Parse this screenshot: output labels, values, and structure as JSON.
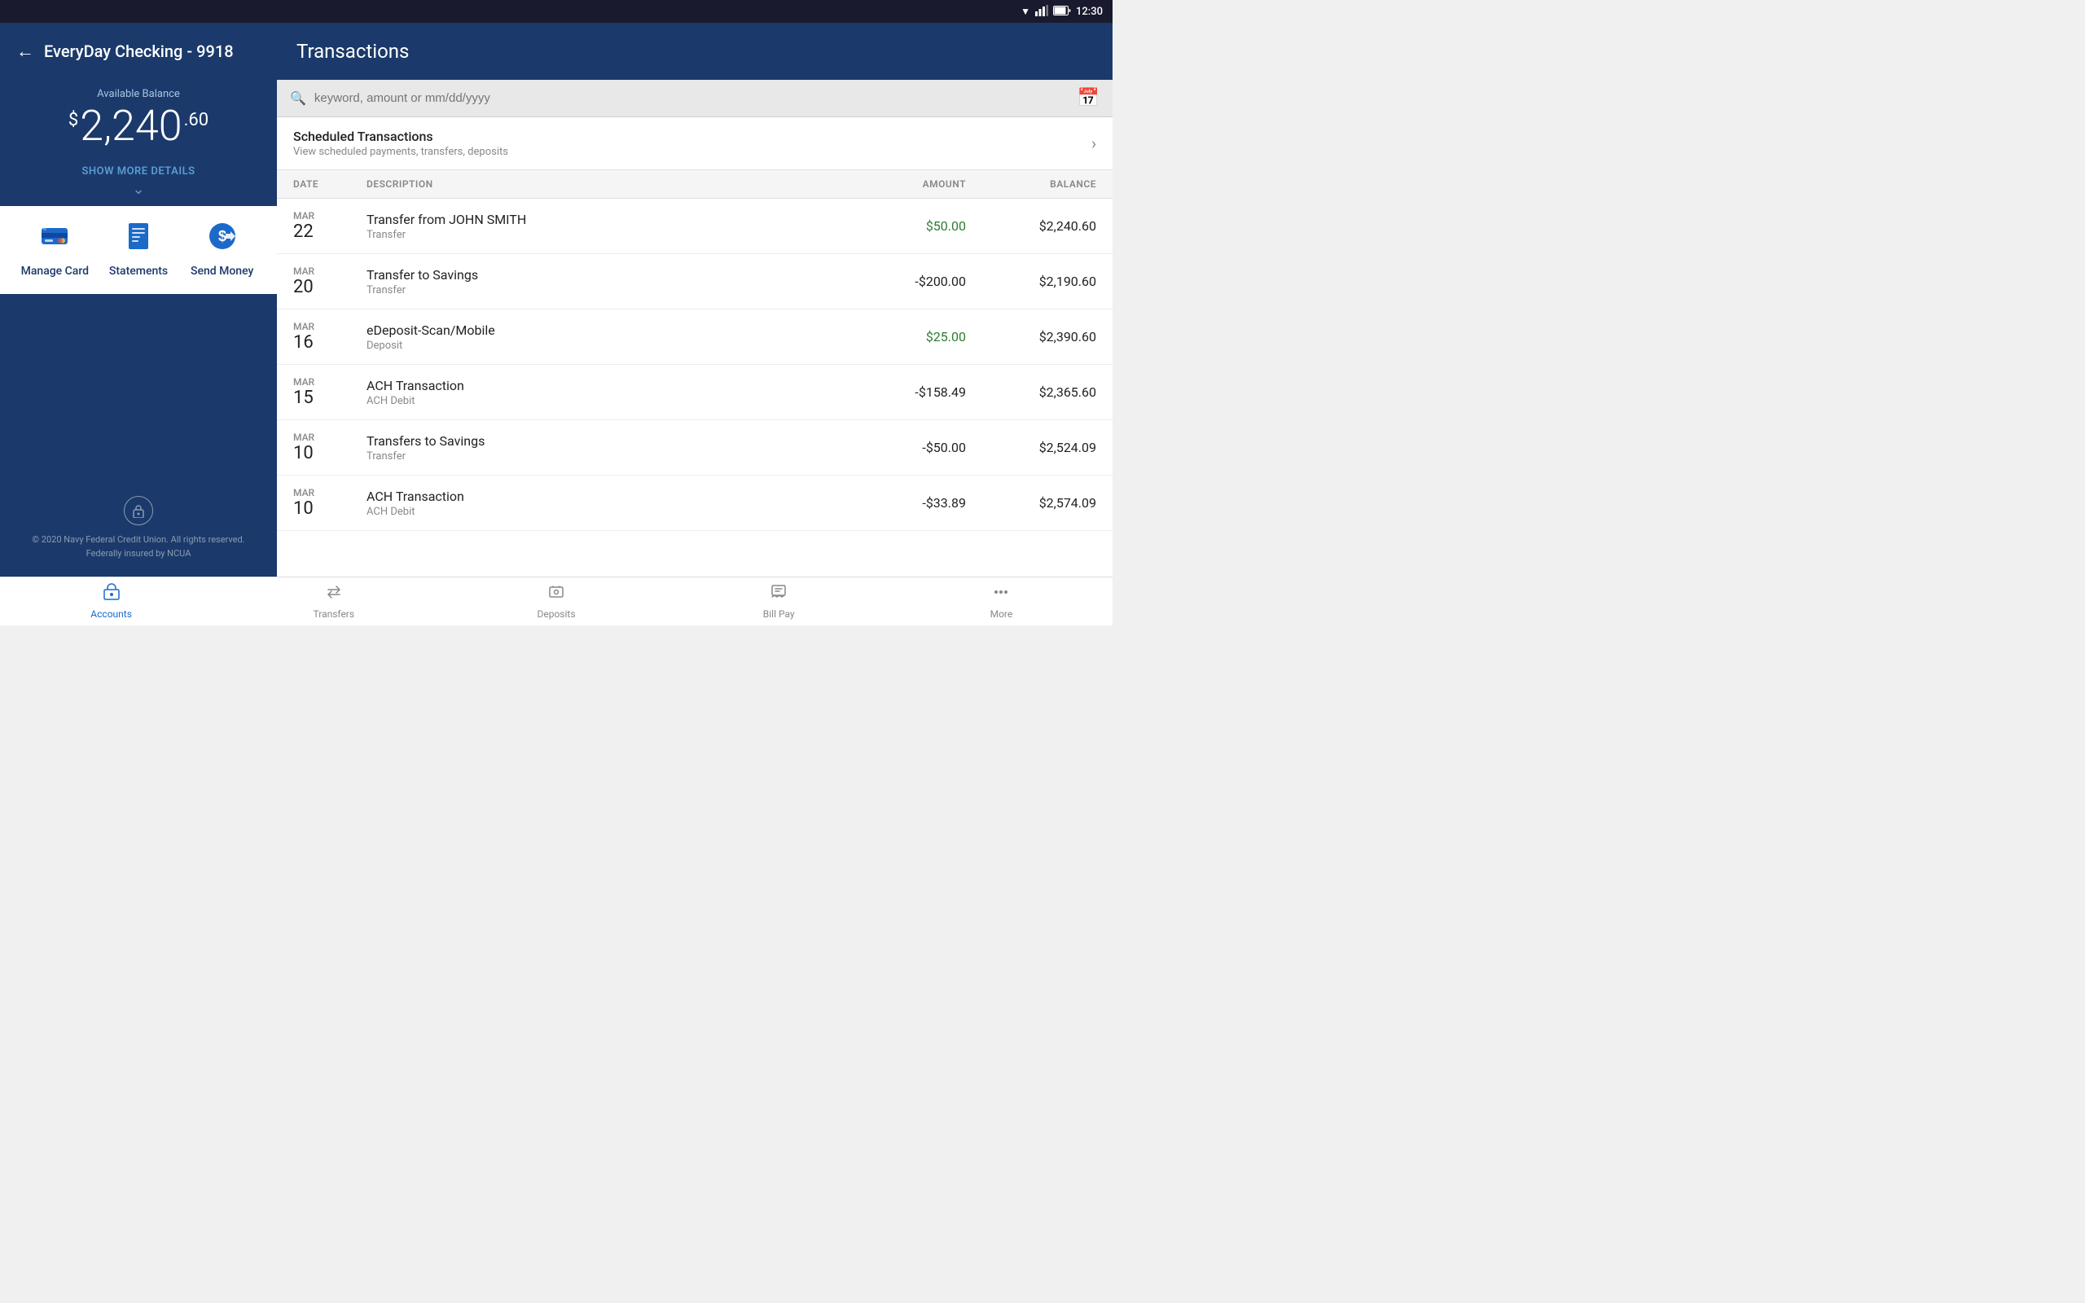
{
  "statusBar": {
    "time": "12:30"
  },
  "sidebar": {
    "backLabel": "←",
    "accountTitle": "EveryDay Checking - 9918",
    "balanceLabel": "Available Balance",
    "balanceDollar": "$",
    "balanceMain": "2,240",
    "balanceCents": ".60",
    "showMoreLabel": "SHOW MORE DETAILS",
    "actions": [
      {
        "id": "manage-card",
        "label": "Manage Card"
      },
      {
        "id": "statements",
        "label": "Statements"
      },
      {
        "id": "send-money",
        "label": "Send Money"
      }
    ],
    "footerCopyright": "© 2020 Navy Federal Credit Union. All rights reserved.",
    "footerInsured": "Federally insured by NCUA"
  },
  "content": {
    "title": "Transactions",
    "searchPlaceholder": "keyword, amount or mm/dd/yyyy",
    "scheduledTitle": "Scheduled Transactions",
    "scheduledSubtitle": "View scheduled payments, transfers, deposits",
    "tableHeaders": {
      "date": "DATE",
      "description": "DESCRIPTION",
      "amount": "AMOUNT",
      "balance": "BALANCE"
    },
    "transactions": [
      {
        "month": "MAR",
        "day": "22",
        "title": "Transfer from JOHN SMITH",
        "subtitle": "Transfer",
        "amount": "$50.00",
        "amountType": "positive",
        "balance": "$2,240.60"
      },
      {
        "month": "MAR",
        "day": "20",
        "title": "Transfer to Savings",
        "subtitle": "Transfer",
        "amount": "-$200.00",
        "amountType": "negative",
        "balance": "$2,190.60"
      },
      {
        "month": "MAR",
        "day": "16",
        "title": "eDeposit-Scan/Mobile",
        "subtitle": "Deposit",
        "amount": "$25.00",
        "amountType": "positive",
        "balance": "$2,390.60"
      },
      {
        "month": "MAR",
        "day": "15",
        "title": "ACH Transaction",
        "subtitle": "ACH Debit",
        "amount": "-$158.49",
        "amountType": "negative",
        "balance": "$2,365.60"
      },
      {
        "month": "MAR",
        "day": "10",
        "title": "Transfers to Savings",
        "subtitle": "Transfer",
        "amount": "-$50.00",
        "amountType": "negative",
        "balance": "$2,524.09"
      },
      {
        "month": "MAR",
        "day": "10",
        "title": "ACH Transaction",
        "subtitle": "ACH Debit",
        "amount": "-$33.89",
        "amountType": "negative",
        "balance": "$2,574.09"
      }
    ]
  },
  "bottomNav": [
    {
      "id": "accounts",
      "label": "Accounts",
      "active": true
    },
    {
      "id": "transfers",
      "label": "Transfers",
      "active": false
    },
    {
      "id": "deposits",
      "label": "Deposits",
      "active": false
    },
    {
      "id": "bill-pay",
      "label": "Bill Pay",
      "active": false
    },
    {
      "id": "more",
      "label": "More",
      "active": false
    }
  ]
}
